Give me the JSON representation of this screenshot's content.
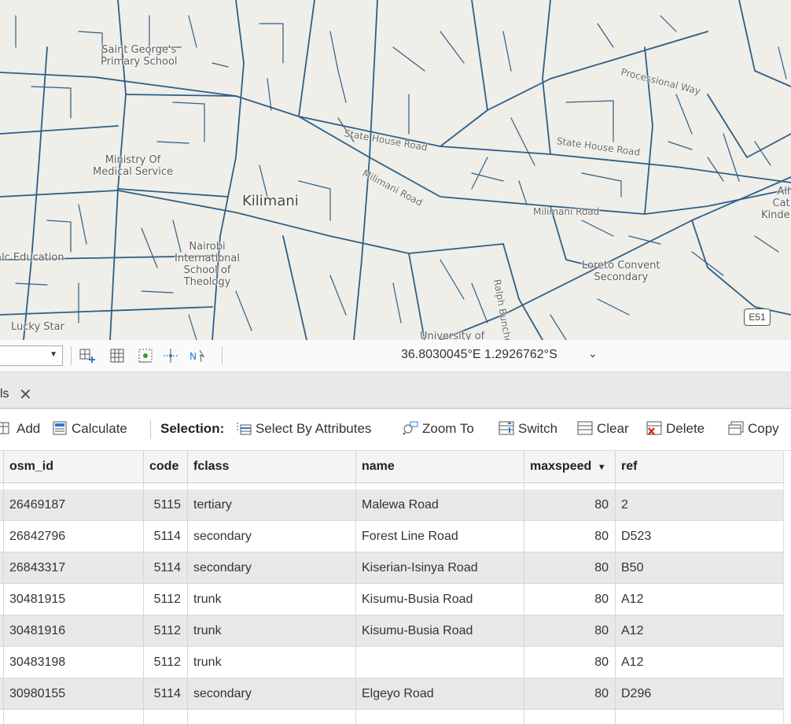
{
  "map": {
    "labels": {
      "saint_george": "Saint George's\nPrimary School",
      "ministry": "Ministry Of\nMedical Service",
      "kilimani": "Kilimani",
      "nairobi_school": "Nairobi\nInternational\nSchool of\nTheology",
      "education": "alc Education",
      "lucky_star": "Lucky Star",
      "loreto": "Loreto Convent\nSecondary",
      "university": "University of",
      "kinder": "All\nCat\nKinde"
    },
    "roads": {
      "processional_way": "Processional Way",
      "state_house_road_1": "State House Road",
      "state_house_road_2": "State House Road",
      "milimani_road_1": "Milimani Road",
      "milimani_road_2": "Milimani Road",
      "ralph_bunche": "Ralph Bunche",
      "shield": "E51"
    },
    "coords": "36.8030045°E 1.2926762°S"
  },
  "tab": {
    "label": "ls"
  },
  "toolbar": {
    "add": "Add",
    "calculate": "Calculate",
    "selection": "Selection:",
    "select_by_attributes": "Select By Attributes",
    "zoom_to": "Zoom To",
    "switch": "Switch",
    "clear": "Clear",
    "delete": "Delete",
    "copy": "Copy"
  },
  "table": {
    "columns": [
      "osm_id",
      "code",
      "fclass",
      "name",
      "maxspeed",
      "ref"
    ],
    "sorted_column_indicator": "▼",
    "rows": [
      [
        "26469187",
        "5115",
        "tertiary",
        "Malewa Road",
        "80",
        "2"
      ],
      [
        "26842796",
        "5114",
        "secondary",
        "Forest Line Road",
        "80",
        "D523"
      ],
      [
        "26843317",
        "5114",
        "secondary",
        "Kiserian-Isinya Road",
        "80",
        "B50"
      ],
      [
        "30481915",
        "5112",
        "trunk",
        "Kisumu-Busia Road",
        "80",
        "A12"
      ],
      [
        "30481916",
        "5112",
        "trunk",
        "Kisumu-Busia Road",
        "80",
        "A12"
      ],
      [
        "30483198",
        "5112",
        "trunk",
        "",
        "80",
        "A12"
      ],
      [
        "30980155",
        "5114",
        "secondary",
        "Elgeyo Road",
        "80",
        "D296"
      ]
    ]
  },
  "colors": {
    "road": "#2e5f86",
    "map_bg": "#efeee8",
    "row_alt": "#e8e8e8"
  }
}
